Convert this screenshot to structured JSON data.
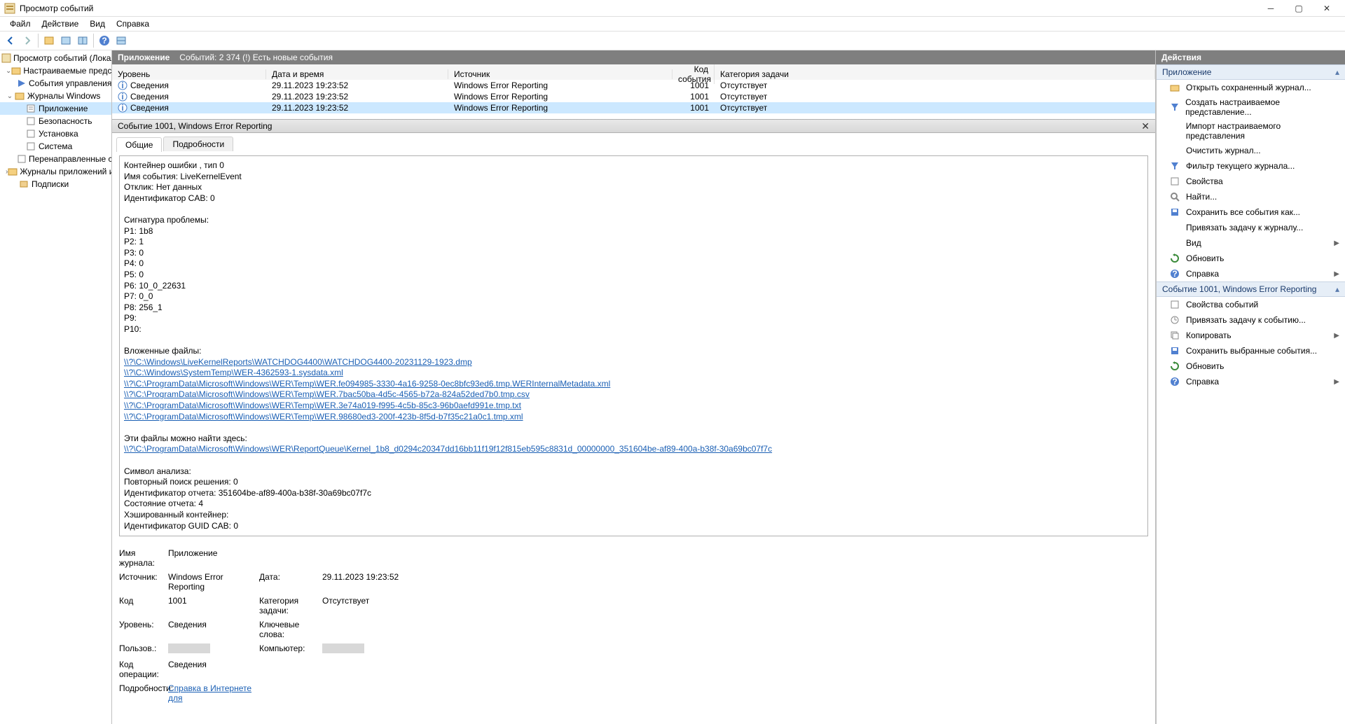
{
  "window": {
    "title": "Просмотр событий"
  },
  "menu": {
    "file": "Файл",
    "action": "Действие",
    "view": "Вид",
    "help": "Справка"
  },
  "tree": {
    "root": "Просмотр событий (Локальны",
    "custom": "Настраиваемые представл",
    "admin": "События управления",
    "windows": "Журналы Windows",
    "app": "Приложение",
    "security": "Безопасность",
    "setup": "Установка",
    "system": "Система",
    "forwarded": "Перенаправленные соб",
    "appsvc": "Журналы приложений и сл",
    "subs": "Подписки"
  },
  "center": {
    "title": "Приложение",
    "subtitle": "Событий: 2 374 (!) Есть новые события"
  },
  "columns": {
    "level": "Уровень",
    "datetime": "Дата и время",
    "source": "Источник",
    "code": "Код события",
    "category": "Категория задачи"
  },
  "rows": [
    {
      "level": "Сведения",
      "dt": "29.11.2023 19:23:52",
      "src": "Windows Error Reporting",
      "code": "1001",
      "cat": "Отсутствует"
    },
    {
      "level": "Сведения",
      "dt": "29.11.2023 19:23:52",
      "src": "Windows Error Reporting",
      "code": "1001",
      "cat": "Отсутствует"
    },
    {
      "level": "Сведения",
      "dt": "29.11.2023 19:23:52",
      "src": "Windows Error Reporting",
      "code": "1001",
      "cat": "Отсутствует"
    }
  ],
  "detail": {
    "title": "Событие 1001, Windows Error Reporting",
    "tab_general": "Общие",
    "tab_details": "Подробности",
    "body_pre": "Контейнер ошибки , тип 0\nИмя события: LiveKernelEvent\nОтклик: Нет данных\nИдентификатор CAB: 0\n\nСигнатура проблемы:\nP1: 1b8\nP2: 1\nP3: 0\nP4: 0\nP5: 0\nP6: 10_0_22631\nP7: 0_0\nP8: 256_1\nP9:\nP10:\n\nВложенные файлы:",
    "links": [
      "\\\\?\\C:\\Windows\\LiveKernelReports\\WATCHDOG4400\\WATCHDOG4400-20231129-1923.dmp",
      "\\\\?\\C:\\Windows\\SystemTemp\\WER-4362593-1.sysdata.xml",
      "\\\\?\\C:\\ProgramData\\Microsoft\\Windows\\WER\\Temp\\WER.fe094985-3330-4a16-9258-0ec8bfc93ed6.tmp.WERInternalMetadata.xml",
      "\\\\?\\C:\\ProgramData\\Microsoft\\Windows\\WER\\Temp\\WER.7bac50ba-4d5c-4565-b72a-824a52ded7b0.tmp.csv",
      "\\\\?\\C:\\ProgramData\\Microsoft\\Windows\\WER\\Temp\\WER.3e74a019-f995-4c5b-85c3-96b0aefd991e.tmp.txt",
      "\\\\?\\C:\\ProgramData\\Microsoft\\Windows\\WER\\Temp\\WER.98680ed3-200f-423b-8f5d-b7f35c21a0c1.tmp.xml"
    ],
    "body_mid": "\nЭти файлы можно найти здесь:",
    "link_queue": "\\\\?\\C:\\ProgramData\\Microsoft\\Windows\\WER\\ReportQueue\\Kernel_1b8_d0294c20347dd16bb11f19f12f815eb595c8831d_00000000_351604be-af89-400a-b38f-30a69bc07f7c",
    "body_post": "\nСимвол анализа:\nПовторный поиск решения: 0\nИдентификатор отчета: 351604be-af89-400a-b38f-30a69bc07f7c\nСостояние отчета: 4\nХэшированный контейнер:\nИдентификатор GUID CAB: 0"
  },
  "meta": {
    "logname_k": "Имя журнала:",
    "logname_v": "Приложение",
    "source_k": "Источник:",
    "source_v": "Windows Error Reporting",
    "date_k": "Дата:",
    "date_v": "29.11.2023 19:23:52",
    "code_k": "Код",
    "code_v": "1001",
    "cat_k": "Категория задачи:",
    "cat_v": "Отсутствует",
    "level_k": "Уровень:",
    "level_v": "Сведения",
    "kw_k": "Ключевые слова:",
    "user_k": "Пользов.:",
    "comp_k": "Компьютер:",
    "op_k": "Код операции:",
    "op_v": "Сведения",
    "more_k": "Подробности:",
    "more_v": "Справка в Интернете для "
  },
  "actions": {
    "header": "Действия",
    "section1": "Приложение",
    "open": "Открыть сохраненный журнал...",
    "create": "Создать настраиваемое представление...",
    "import": "Импорт настраиваемого представления",
    "clear": "Очистить журнал...",
    "filter": "Фильтр текущего журнала...",
    "props": "Свойства",
    "find": "Найти...",
    "saveall": "Сохранить все события как...",
    "attach": "Привязать задачу к журналу...",
    "view": "Вид",
    "refresh": "Обновить",
    "help": "Справка",
    "section2": "Событие 1001, Windows Error Reporting",
    "evprops": "Свойства событий",
    "evattach": "Привязать задачу к событию...",
    "copy": "Копировать",
    "savesel": "Сохранить выбранные события...",
    "refresh2": "Обновить",
    "help2": "Справка"
  }
}
